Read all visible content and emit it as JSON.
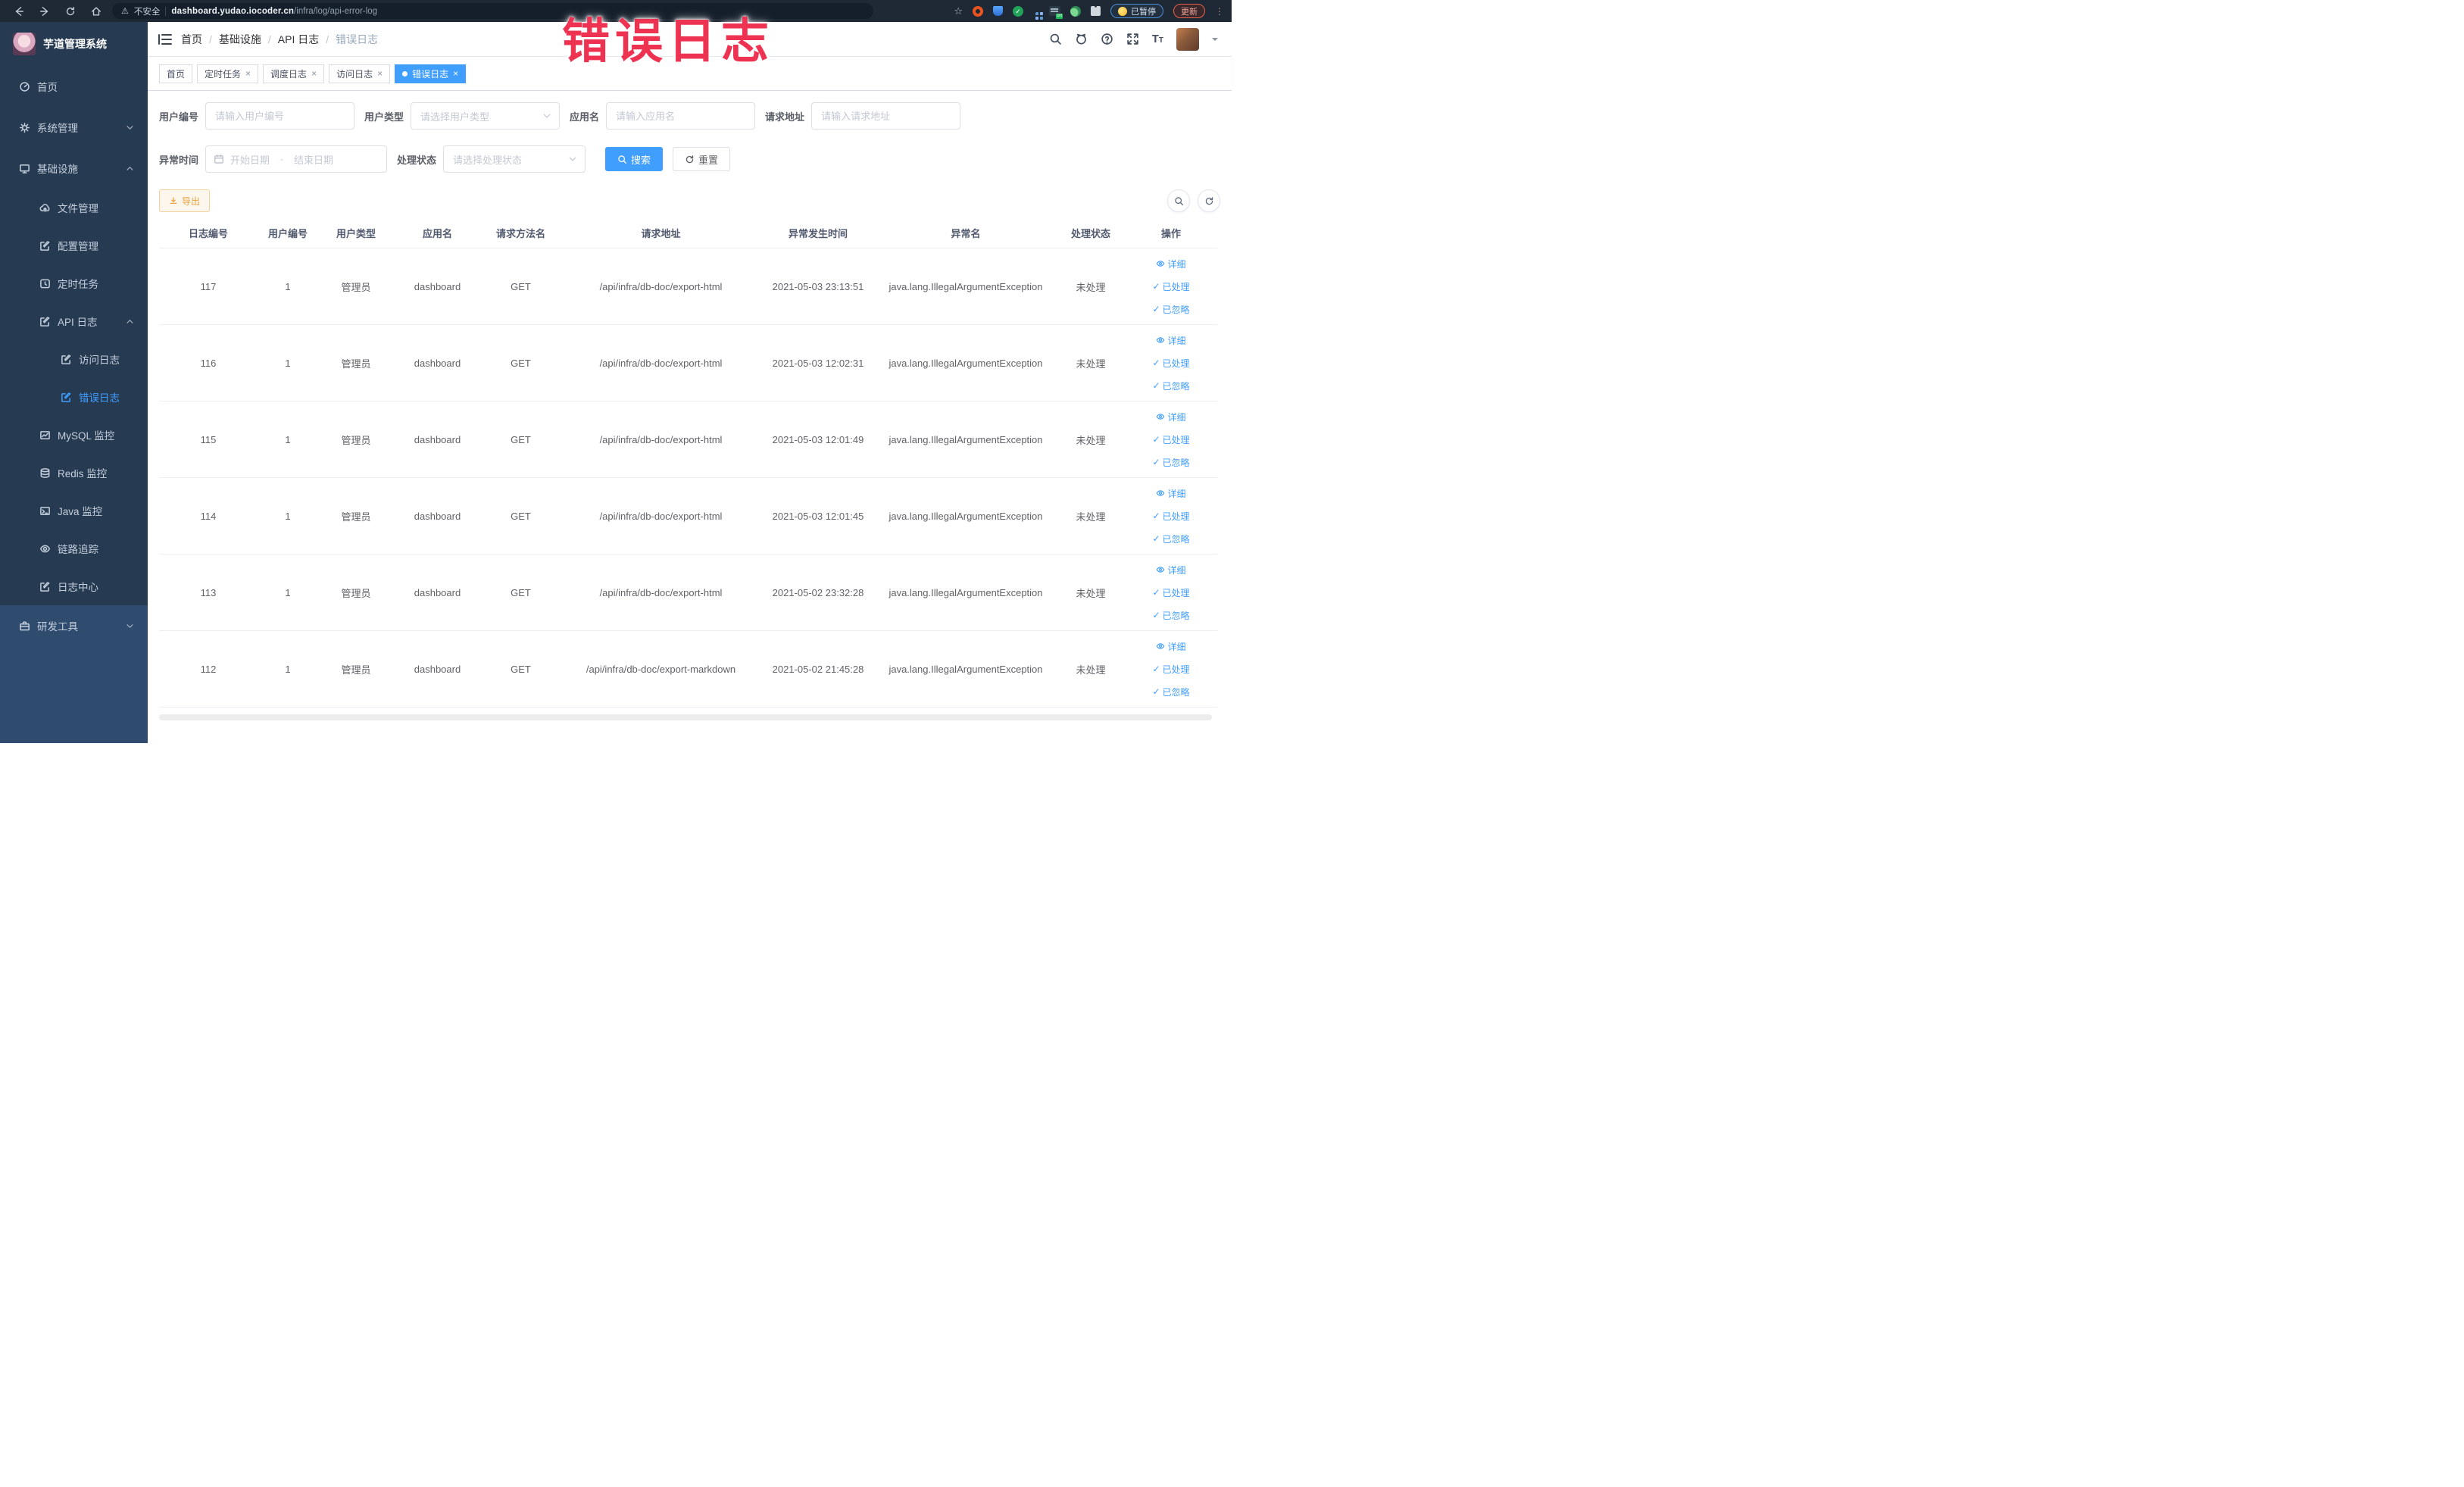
{
  "annotation": {
    "text": "错误日志"
  },
  "icons": {
    "close": "×",
    "check": "✓",
    "warning": "⚠",
    "star": "☆",
    "kebab": "⋮",
    "separator": "/"
  },
  "browser": {
    "security_label": "不安全",
    "url_domain": "dashboard.yudao.iocoder.cn",
    "url_path": "/infra/log/api-error-log",
    "paused_badge": "已暂停",
    "update_button": "更新"
  },
  "sidebar": {
    "logo_title": "芋道管理系统",
    "items": [
      {
        "label": "首页"
      },
      {
        "label": "系统管理"
      },
      {
        "label": "基础设施"
      },
      {
        "label": "文件管理"
      },
      {
        "label": "配置管理"
      },
      {
        "label": "定时任务"
      },
      {
        "label": "API 日志"
      },
      {
        "label": "访问日志"
      },
      {
        "label": "错误日志"
      },
      {
        "label": "MySQL 监控"
      },
      {
        "label": "Redis 监控"
      },
      {
        "label": "Java 监控"
      },
      {
        "label": "链路追踪"
      },
      {
        "label": "日志中心"
      },
      {
        "label": "研发工具"
      }
    ]
  },
  "header": {
    "breadcrumb": [
      "首页",
      "基础设施",
      "API 日志",
      "错误日志"
    ],
    "font_icon_big": "T",
    "font_icon_small": "T"
  },
  "tabs": [
    {
      "label": "首页"
    },
    {
      "label": "定时任务"
    },
    {
      "label": "调度日志"
    },
    {
      "label": "访问日志"
    },
    {
      "label": "错误日志"
    }
  ],
  "filters": {
    "user_id_label": "用户编号",
    "user_id_placeholder": "请输入用户编号",
    "user_type_label": "用户类型",
    "user_type_placeholder": "请选择用户类型",
    "app_name_label": "应用名",
    "app_name_placeholder": "请输入应用名",
    "request_url_label": "请求地址",
    "request_url_placeholder": "请输入请求地址",
    "exception_time_label": "异常时间",
    "date_start_placeholder": "开始日期",
    "date_range_separator": "-",
    "date_end_placeholder": "结束日期",
    "process_status_label": "处理状态",
    "process_status_placeholder": "请选择处理状态",
    "search_button": "搜索",
    "reset_button": "重置"
  },
  "toolbar": {
    "export_button": "导出"
  },
  "table": {
    "columns": [
      "日志编号",
      "用户编号",
      "用户类型",
      "应用名",
      "请求方法名",
      "请求地址",
      "异常发生时间",
      "异常名",
      "处理状态",
      "操作"
    ],
    "actions": [
      "详细",
      "已处理",
      "已忽略"
    ],
    "rows": [
      {
        "id": "117",
        "user_id": "1",
        "user_type": "管理员",
        "app_name": "dashboard",
        "method": "GET",
        "url": "/api/infra/db-doc/export-html",
        "time": "2021-05-03 23:13:51",
        "exception": "java.lang.IllegalArgumentException",
        "status": "未处理"
      },
      {
        "id": "116",
        "user_id": "1",
        "user_type": "管理员",
        "app_name": "dashboard",
        "method": "GET",
        "url": "/api/infra/db-doc/export-html",
        "time": "2021-05-03 12:02:31",
        "exception": "java.lang.IllegalArgumentException",
        "status": "未处理"
      },
      {
        "id": "115",
        "user_id": "1",
        "user_type": "管理员",
        "app_name": "dashboard",
        "method": "GET",
        "url": "/api/infra/db-doc/export-html",
        "time": "2021-05-03 12:01:49",
        "exception": "java.lang.IllegalArgumentException",
        "status": "未处理"
      },
      {
        "id": "114",
        "user_id": "1",
        "user_type": "管理员",
        "app_name": "dashboard",
        "method": "GET",
        "url": "/api/infra/db-doc/export-html",
        "time": "2021-05-03 12:01:45",
        "exception": "java.lang.IllegalArgumentException",
        "status": "未处理"
      },
      {
        "id": "113",
        "user_id": "1",
        "user_type": "管理员",
        "app_name": "dashboard",
        "method": "GET",
        "url": "/api/infra/db-doc/export-html",
        "time": "2021-05-02 23:32:28",
        "exception": "java.lang.IllegalArgumentException",
        "status": "未处理"
      },
      {
        "id": "112",
        "user_id": "1",
        "user_type": "管理员",
        "app_name": "dashboard",
        "method": "GET",
        "url": "/api/infra/db-doc/export-markdown",
        "time": "2021-05-02 21:45:28",
        "exception": "java.lang.IllegalArgumentException",
        "status": "未处理"
      }
    ]
  }
}
